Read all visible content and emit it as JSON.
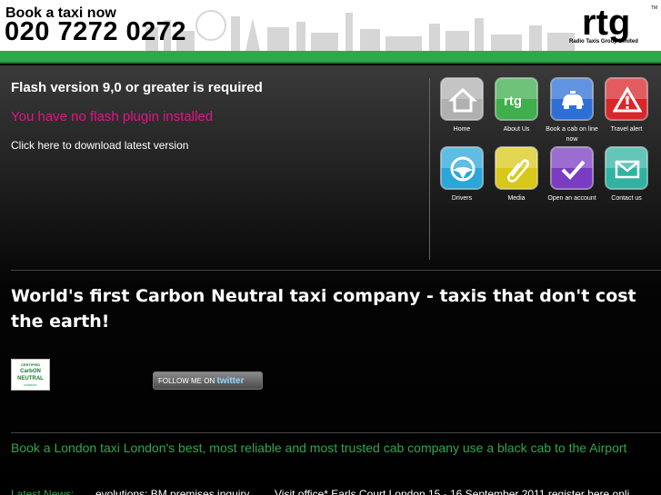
{
  "header": {
    "book_label": "Book a taxi now",
    "phone": "020 7272 0272",
    "logo_text": "rtg",
    "logo_tm": "TM",
    "logo_tagline": "Radio Taxis Group Limited",
    "accent_green": "#2fa84a"
  },
  "flash": {
    "title": "Flash version 9,0 or greater is required",
    "missing": "You have no flash plugin installed",
    "download": "Click here to download latest version",
    "missing_color": "#e0148a"
  },
  "nav": {
    "items": [
      {
        "label": "Home",
        "icon": "home-icon",
        "color": "#b0b0b0"
      },
      {
        "label": "About Us",
        "icon": "rtg-icon",
        "color": "#3fae4c"
      },
      {
        "label": "Book a cab on line now",
        "icon": "taxi-icon",
        "color": "#2e6fd6"
      },
      {
        "label": "Travel alert",
        "icon": "warning-icon",
        "color": "#d8262a"
      },
      {
        "label": "Drivers",
        "icon": "steering-wheel-icon",
        "color": "#2aa6d9"
      },
      {
        "label": "Media",
        "icon": "paperclip-icon",
        "color": "#d8c81a"
      },
      {
        "label": "Open an account",
        "icon": "checkmark-icon",
        "color": "#7a3cc2"
      },
      {
        "label": "Contact us",
        "icon": "envelope-icon",
        "color": "#2fb3a0"
      }
    ]
  },
  "headline": "World's first Carbon Neutral taxi company - taxis that don't cost the earth!",
  "badge": {
    "top": "CERTIFIED",
    "main_1": "CarbON",
    "main_2": "NEUTRAL",
    "sub": "COMPANY"
  },
  "twitter": {
    "prefix": "FOLLOW ME ON",
    "brand": "twitter"
  },
  "cta": "Book a London taxi London's best, most reliable and most trusted cab company use a black cab to the Airport",
  "news": {
    "label": "Latest News:",
    "item_1": "...evolutions: BM premises inquiry",
    "item_2": "Visit office* Earls Court London 15 - 16 September 2011 register here onli"
  }
}
